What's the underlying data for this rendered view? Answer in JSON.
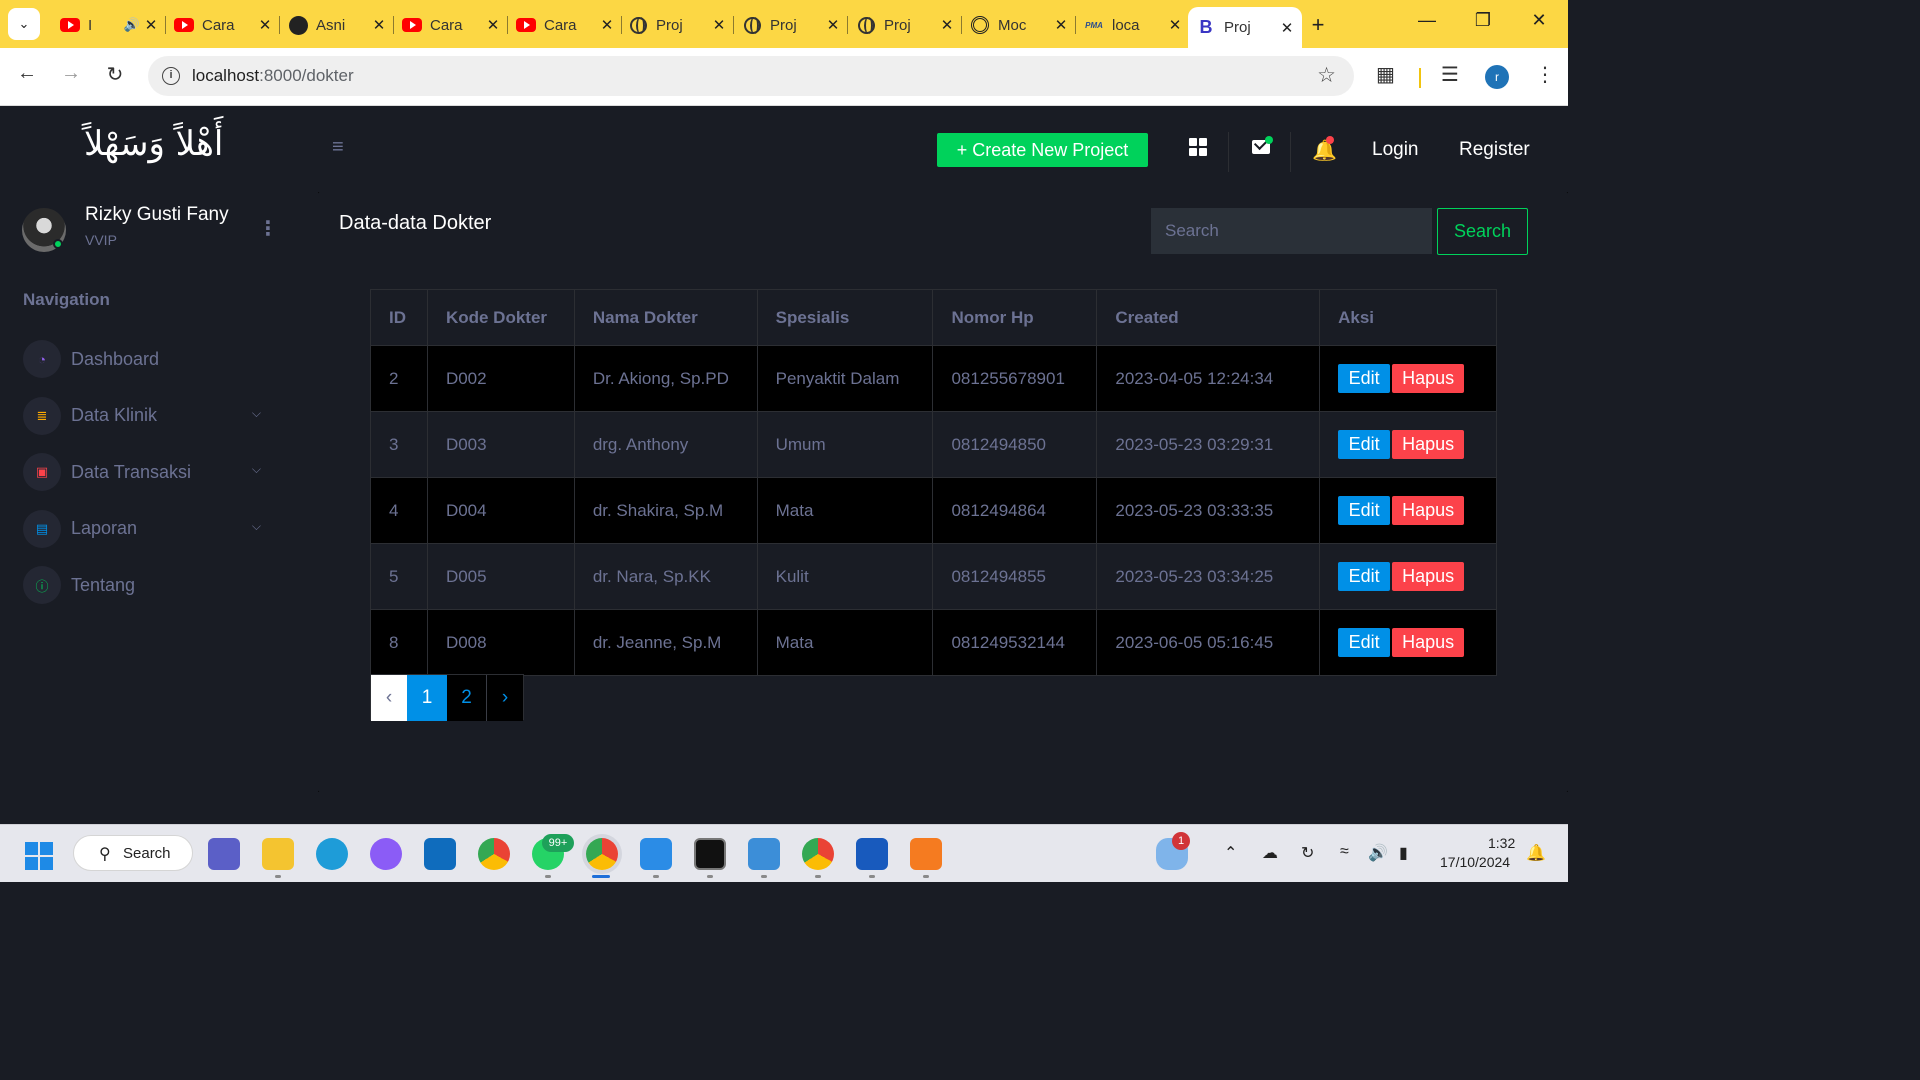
{
  "browser": {
    "tabs": [
      {
        "title": "I",
        "icon": "youtube-icon",
        "audio": true
      },
      {
        "title": "Cara",
        "icon": "youtube-icon"
      },
      {
        "title": "Asni",
        "icon": "github-icon"
      },
      {
        "title": "Cara",
        "icon": "youtube-icon"
      },
      {
        "title": "Cara",
        "icon": "youtube-icon"
      },
      {
        "title": "Proj",
        "icon": "globe-icon"
      },
      {
        "title": "Proj",
        "icon": "globe-icon"
      },
      {
        "title": "Proj",
        "icon": "globe-icon"
      },
      {
        "title": "Moc",
        "icon": "chatgpt-icon"
      },
      {
        "title": "loca",
        "icon": "phpmyadmin-icon",
        "icon_text": "PMA"
      },
      {
        "title": "Proj",
        "icon": "bootstrap-icon",
        "icon_text": "B",
        "active": true
      }
    ],
    "url_host": "localhost",
    "url_path": ":8000/dokter",
    "profile_initial": "r",
    "tab_bar_color": "#fcd744"
  },
  "app": {
    "brand": "أَهْلاً وَسَهْلاً",
    "user": {
      "name": "Rizky Gusti Fany",
      "role": "VVIP"
    },
    "nav_caption": "Navigation",
    "nav": [
      {
        "label": "Dashboard",
        "icon": "speedometer-icon",
        "color": "#8f5fe8",
        "has_submenu": false
      },
      {
        "label": "Data Klinik",
        "icon": "database-icon",
        "color": "#ffab00",
        "has_submenu": true
      },
      {
        "label": "Data Transaksi",
        "icon": "cash-icon",
        "color": "#fc424a",
        "has_submenu": true
      },
      {
        "label": "Laporan",
        "icon": "clipboard-icon",
        "color": "#0090e7",
        "has_submenu": true
      },
      {
        "label": "Tentang",
        "icon": "info-icon",
        "color": "#00d25b",
        "has_submenu": false
      }
    ],
    "topnav": {
      "create_label": "+ Create New Project",
      "login": "Login",
      "register": "Register"
    },
    "page_title": "Data-data Dokter",
    "search": {
      "placeholder": "Search",
      "button": "Search"
    },
    "table": {
      "headers": [
        "ID",
        "Kode Dokter",
        "Nama Dokter",
        "Spesialis",
        "Nomor Hp",
        "Created",
        "Aksi"
      ],
      "rows": [
        [
          "2",
          "D002",
          "Dr. Akiong, Sp.PD",
          "Penyaktit Dalam",
          "081255678901",
          "2023-04-05 12:24:34"
        ],
        [
          "3",
          "D003",
          "drg. Anthony",
          "Umum",
          "0812494850",
          "2023-05-23 03:29:31"
        ],
        [
          "4",
          "D004",
          "dr. Shakira, Sp.M",
          "Mata",
          "0812494864",
          "2023-05-23 03:33:35"
        ],
        [
          "5",
          "D005",
          "dr. Nara, Sp.KK",
          "Kulit",
          "0812494855",
          "2023-05-23 03:34:25"
        ],
        [
          "8",
          "D008",
          "dr. Jeanne, Sp.M",
          "Mata",
          "081249532144",
          "2023-06-05 05:16:45"
        ]
      ],
      "edit_label": "Edit",
      "delete_label": "Hapus"
    },
    "pagination": {
      "prev": "‹",
      "pages": [
        "1",
        "2"
      ],
      "current": "1",
      "next": "›"
    },
    "colors": {
      "success": "#00d25b",
      "primary": "#0090e7",
      "danger": "#fc424a",
      "muted": "#6c7293",
      "background": "#191c24"
    }
  },
  "taskbar": {
    "search_label": "Search",
    "whatsapp_badge": "99+",
    "weather_badge": "1",
    "time": "1:32",
    "date": "17/10/2024"
  }
}
